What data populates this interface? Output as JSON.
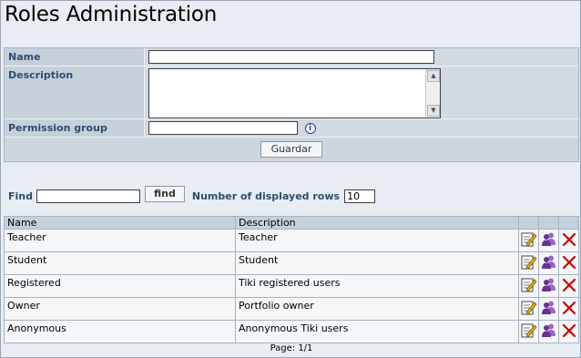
{
  "page": {
    "title": "Roles Administration"
  },
  "form": {
    "name_label": "Name",
    "name_value": "",
    "description_label": "Description",
    "description_value": "",
    "permission_group_label": "Permission group",
    "permission_group_value": "",
    "info_icon_glyph": "i",
    "save_label": "Guardar"
  },
  "find": {
    "label": "Find",
    "value": "",
    "button_label": "find",
    "rows_label": "Number of displayed rows",
    "rows_value": "10"
  },
  "table": {
    "headers": [
      "Name",
      "Description"
    ],
    "rows": [
      {
        "name": "Teacher",
        "description": "Teacher"
      },
      {
        "name": "Student",
        "description": "Student"
      },
      {
        "name": "Registered",
        "description": "Tiki registered users"
      },
      {
        "name": "Owner",
        "description": "Portfolio owner"
      },
      {
        "name": "Anonymous",
        "description": "Anonymous Tiki users"
      }
    ],
    "action_icons": [
      "edit-icon",
      "group-permissions-icon",
      "delete-icon"
    ]
  },
  "pagination": {
    "text": "Page: 1/1"
  },
  "colors": {
    "label_text": "#2f4d70",
    "delete": "#cc0000",
    "users": "#7a3fa0"
  }
}
